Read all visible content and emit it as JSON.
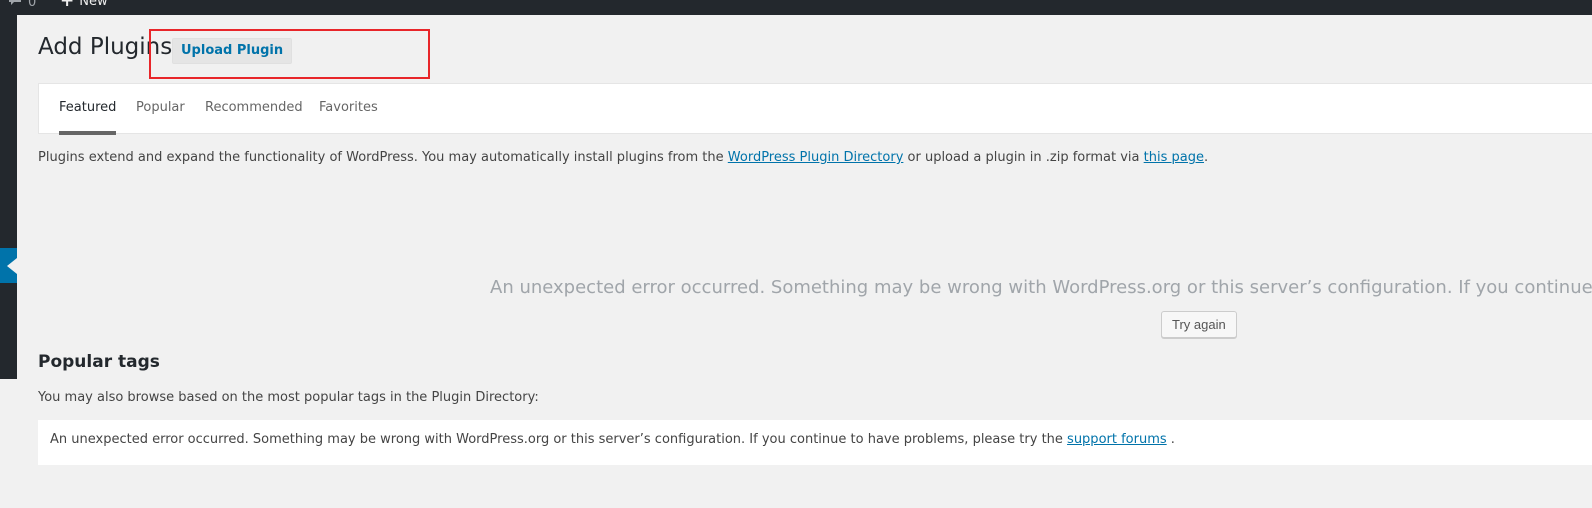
{
  "adminbar": {
    "comments_count": "0",
    "new_label": "New"
  },
  "header": {
    "title": "Add Plugins",
    "upload_label": "Upload Plugin"
  },
  "tabs": [
    {
      "label": "Featured"
    },
    {
      "label": "Popular"
    },
    {
      "label": "Recommended"
    },
    {
      "label": "Favorites"
    }
  ],
  "description": {
    "text_before": "Plugins extend and expand the functionality of WordPress. You may automatically install plugins from the ",
    "directory_link": "WordPress Plugin Directory",
    "text_middle": " or upload a plugin in .zip format via ",
    "page_link": "this page",
    "text_after": "."
  },
  "error": {
    "message": "An unexpected error occurred. Something may be wrong with WordPress.org or this server’s configuration. If you continue to have",
    "try_again_label": "Try again"
  },
  "popular_tags": {
    "title": "Popular tags",
    "description": "You may also browse based on the most popular tags in the Plugin Directory:",
    "error_text": "An unexpected error occurred. Something may be wrong with WordPress.org or this server’s configuration. If you continue to have problems, please try the ",
    "support_link": "support forums",
    "error_end": " ."
  },
  "colors": {
    "accent": "#0073aa",
    "admin_bar": "#23282d",
    "background": "#f1f1f1",
    "highlight_box": "#e8262a"
  }
}
